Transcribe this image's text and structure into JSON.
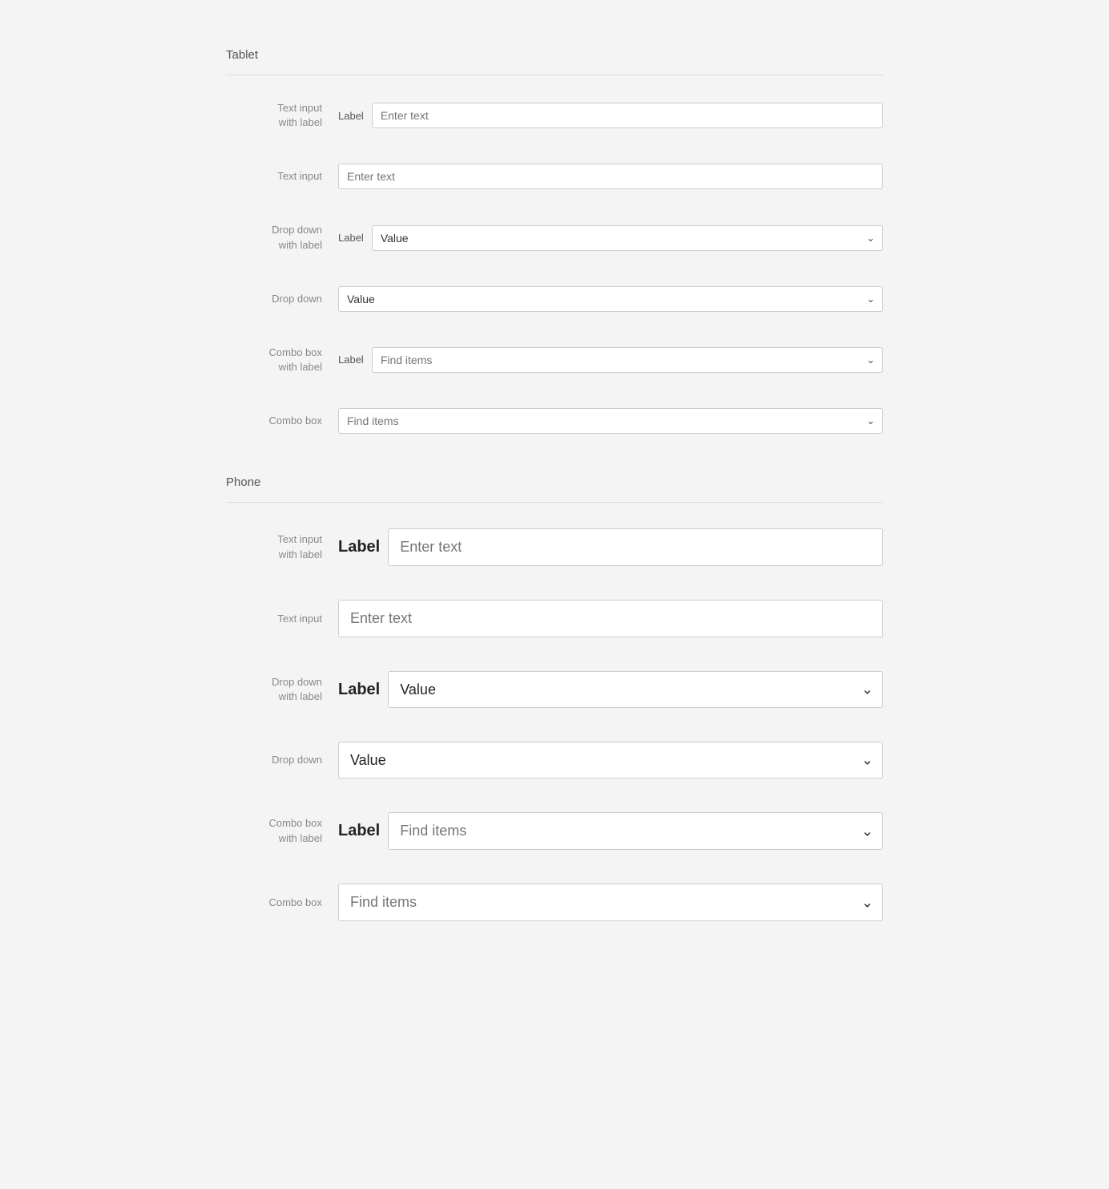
{
  "tablet": {
    "section_title": "Tablet",
    "rows": [
      {
        "id": "text-input-with-label",
        "row_label": "Text input\nwith label",
        "type": "text-input-labeled",
        "field_label": "Label",
        "placeholder": "Enter text"
      },
      {
        "id": "text-input",
        "row_label": "Text input",
        "type": "text-input",
        "placeholder": "Enter text"
      },
      {
        "id": "dropdown-with-label",
        "row_label": "Drop down\nwith label",
        "type": "dropdown-labeled",
        "field_label": "Label",
        "value": "Value"
      },
      {
        "id": "dropdown",
        "row_label": "Drop down",
        "type": "dropdown",
        "value": "Value"
      },
      {
        "id": "combo-with-label",
        "row_label": "Combo box\nwith label",
        "type": "combo-labeled",
        "field_label": "Label",
        "placeholder": "Find items"
      },
      {
        "id": "combo",
        "row_label": "Combo box",
        "type": "combo",
        "placeholder": "Find items"
      }
    ]
  },
  "phone": {
    "section_title": "Phone",
    "rows": [
      {
        "id": "phone-text-input-with-label",
        "row_label": "Text input\nwith label",
        "type": "text-input-labeled",
        "field_label": "Label",
        "placeholder": "Enter text"
      },
      {
        "id": "phone-text-input",
        "row_label": "Text input",
        "type": "text-input",
        "placeholder": "Enter text"
      },
      {
        "id": "phone-dropdown-with-label",
        "row_label": "Drop down\nwith label",
        "type": "dropdown-labeled",
        "field_label": "Label",
        "value": "Value"
      },
      {
        "id": "phone-dropdown",
        "row_label": "Drop down",
        "type": "dropdown",
        "value": "Value"
      },
      {
        "id": "phone-combo-with-label",
        "row_label": "Combo box\nwith label",
        "type": "combo-labeled",
        "field_label": "Label",
        "placeholder": "Find items"
      },
      {
        "id": "phone-combo",
        "row_label": "Combo box",
        "type": "combo",
        "placeholder": "Find items"
      }
    ]
  },
  "icons": {
    "chevron_down": "&#x2304;"
  }
}
